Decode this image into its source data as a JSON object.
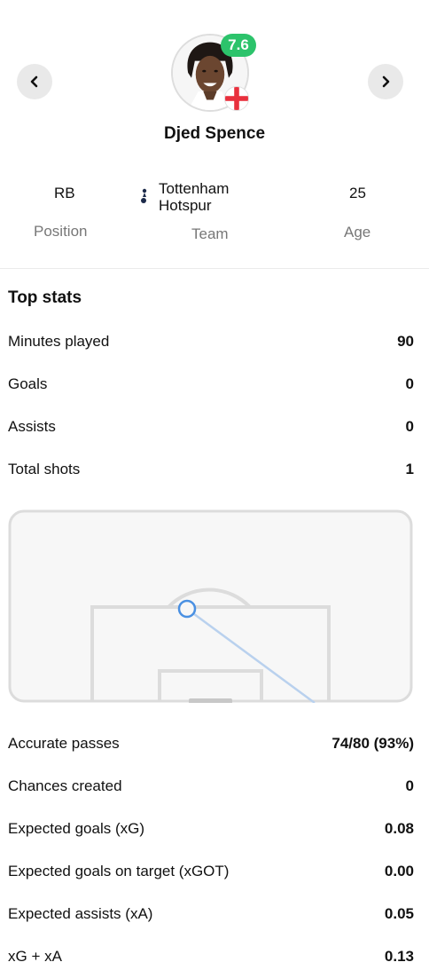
{
  "player": {
    "name": "Djed Spence",
    "rating": "7.6",
    "rating_color": "#2cc36b",
    "nationality_flag": "england-flag-icon"
  },
  "nav": {
    "prev_icon": "chevron-left-icon",
    "next_icon": "chevron-right-icon"
  },
  "info": {
    "position": {
      "value": "RB",
      "label": "Position"
    },
    "team": {
      "value_line1": "Tottenham",
      "value_line2": "Hotspur",
      "label": "Team",
      "logo": "tottenham-crest-icon"
    },
    "age": {
      "value": "25",
      "label": "Age"
    }
  },
  "top_stats": {
    "title": "Top stats",
    "rows": [
      {
        "label": "Minutes played",
        "value": "90"
      },
      {
        "label": "Goals",
        "value": "0"
      },
      {
        "label": "Assists",
        "value": "0"
      },
      {
        "label": "Total shots",
        "value": "1"
      }
    ]
  },
  "shot_map": {
    "shots": [
      {
        "type": "off-target",
        "color": "#4a90e2"
      }
    ]
  },
  "more_stats": {
    "rows": [
      {
        "label": "Accurate passes",
        "value": "74/80 (93%)"
      },
      {
        "label": "Chances created",
        "value": "0"
      },
      {
        "label": "Expected goals (xG)",
        "value": "0.08"
      },
      {
        "label": "Expected goals on target (xGOT)",
        "value": "0.00"
      },
      {
        "label": "Expected assists (xA)",
        "value": "0.05"
      },
      {
        "label": "xG + xA",
        "value": "0.13"
      }
    ]
  }
}
